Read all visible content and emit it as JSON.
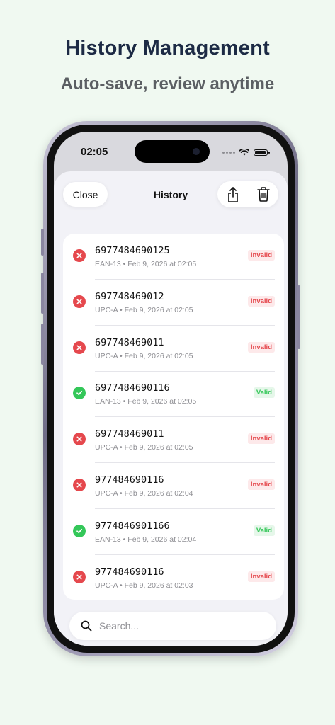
{
  "headline": "History Management",
  "subline": "Auto-save, review anytime",
  "status_bar": {
    "time": "02:05"
  },
  "sheet": {
    "close_label": "Close",
    "title": "History"
  },
  "history": [
    {
      "code": "6977484690125",
      "type": "EAN-13",
      "timestamp": "Feb 9, 2026 at 02:05",
      "status": "invalid",
      "badge": "Invalid"
    },
    {
      "code": "697748469012",
      "type": "UPC-A",
      "timestamp": "Feb 9, 2026 at 02:05",
      "status": "invalid",
      "badge": "Invalid"
    },
    {
      "code": "697748469011",
      "type": "UPC-A",
      "timestamp": "Feb 9, 2026 at 02:05",
      "status": "invalid",
      "badge": "Invalid"
    },
    {
      "code": "6977484690116",
      "type": "EAN-13",
      "timestamp": "Feb 9, 2026 at 02:05",
      "status": "valid",
      "badge": "Valid"
    },
    {
      "code": "697748469011",
      "type": "UPC-A",
      "timestamp": "Feb 9, 2026 at 02:05",
      "status": "invalid",
      "badge": "Invalid"
    },
    {
      "code": "977484690116",
      "type": "UPC-A",
      "timestamp": "Feb 9, 2026 at 02:04",
      "status": "invalid",
      "badge": "Invalid"
    },
    {
      "code": "9774846901166",
      "type": "EAN-13",
      "timestamp": "Feb 9, 2026 at 02:04",
      "status": "valid",
      "badge": "Valid"
    },
    {
      "code": "977484690116",
      "type": "UPC-A",
      "timestamp": "Feb 9, 2026 at 02:03",
      "status": "invalid",
      "badge": "Invalid"
    }
  ],
  "search": {
    "placeholder": "Search..."
  },
  "icons": {
    "share": "share-icon",
    "trash": "trash-icon",
    "search": "search-icon",
    "invalid": "x-circle-icon",
    "valid": "check-circle-icon"
  },
  "colors": {
    "background": "#f0f9f1",
    "headline": "#1d2b45",
    "invalid": "#e5484d",
    "valid": "#34c759"
  }
}
